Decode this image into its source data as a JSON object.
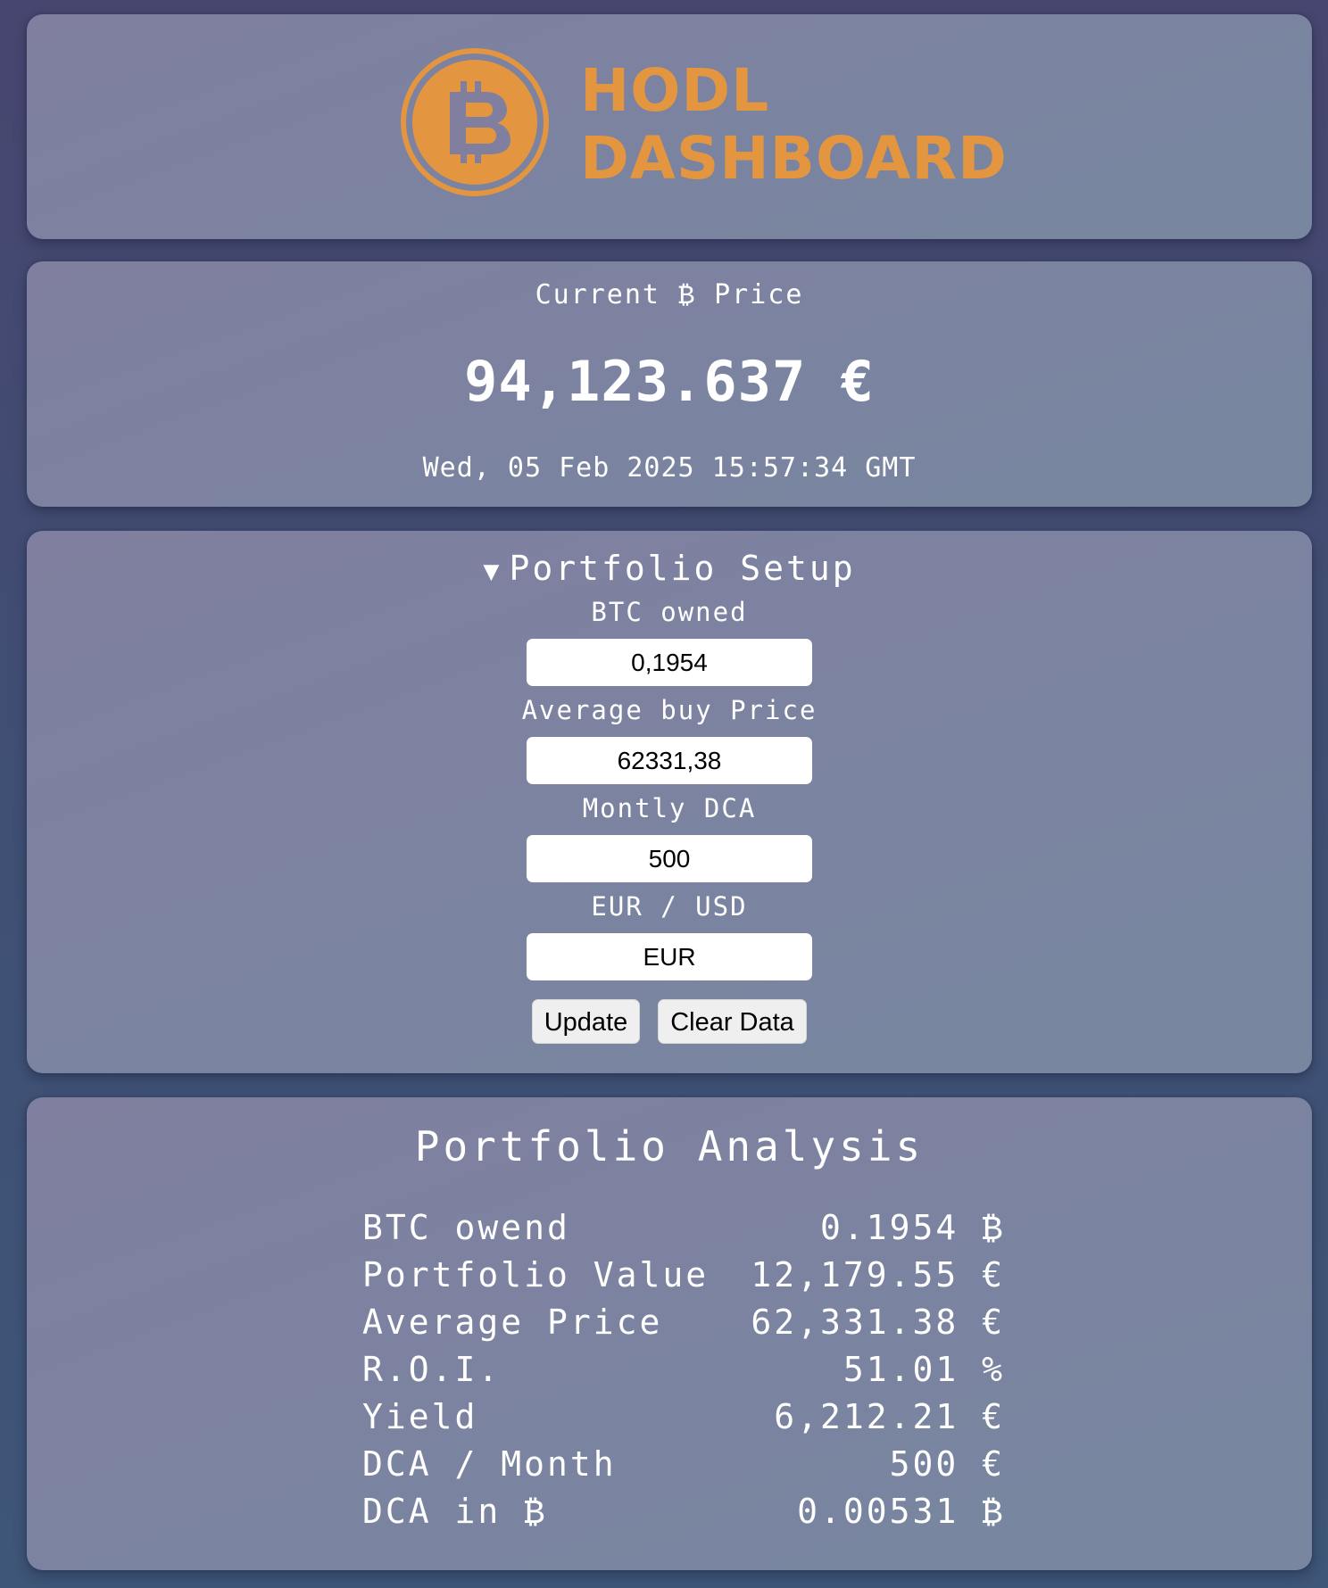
{
  "header": {
    "logo_line1": "HODL",
    "logo_line2": "DASHBOARD",
    "logo_color": "#e3963f"
  },
  "price": {
    "label": "Current ₿ Price",
    "value": "94,123.637 €",
    "timestamp": "Wed, 05 Feb 2025 15:57:34 GMT"
  },
  "setup": {
    "title": "Portfolio Setup",
    "toggle_icon": "▼",
    "fields": [
      {
        "label": "BTC owned",
        "value": "0,1954"
      },
      {
        "label": "Average buy Price",
        "value": "62331,38"
      },
      {
        "label": "Montly DCA",
        "value": "500"
      },
      {
        "label": "EUR / USD",
        "value": "EUR"
      }
    ],
    "update_label": "Update",
    "clear_label": "Clear Data"
  },
  "analysis": {
    "title": "Portfolio Analysis",
    "rows": [
      {
        "label": "BTC owend",
        "value": "0.1954 ₿"
      },
      {
        "label": "Portfolio Value",
        "value": "12,179.55 €"
      },
      {
        "label": "Average Price",
        "value": "62,331.38 €"
      },
      {
        "label": "R.O.I.",
        "value": "51.01 %"
      },
      {
        "label": "Yield",
        "value": "6,212.21 €"
      },
      {
        "label": "DCA / Month",
        "value": "500 €"
      },
      {
        "label": "DCA in ₿",
        "value": "0.00531 ₿"
      }
    ]
  }
}
